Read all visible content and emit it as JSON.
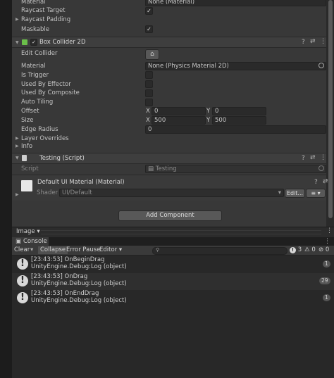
{
  "inspector": {
    "image_component": {
      "material_label": "Material",
      "material_value": "None (Material)",
      "raycast_target_label": "Raycast Target",
      "raycast_padding_label": "Raycast Padding",
      "maskable_label": "Maskable"
    },
    "box_collider": {
      "title": "Box Collider 2D",
      "edit_collider_label": "Edit Collider",
      "material_label": "Material",
      "material_value": "None (Physics Material 2D)",
      "is_trigger_label": "Is Trigger",
      "used_by_effector_label": "Used By Effector",
      "used_by_composite_label": "Used By Composite",
      "auto_tiling_label": "Auto Tiling",
      "offset_label": "Offset",
      "offset_x": "0",
      "offset_y": "0",
      "size_label": "Size",
      "size_x": "500",
      "size_y": "500",
      "edge_radius_label": "Edge Radius",
      "edge_radius_value": "0",
      "layer_overrides_label": "Layer Overrides",
      "info_label": "Info",
      "x_label": "X",
      "y_label": "Y"
    },
    "testing_script": {
      "title": "Testing (Script)",
      "script_label": "Script",
      "script_value": "Testing"
    },
    "material": {
      "title": "Default UI Material (Material)",
      "shader_label": "Shader",
      "shader_value": "UI/Default",
      "edit_label": "Edit..."
    },
    "add_component_label": "Add Component",
    "preview_label": "Image"
  },
  "console": {
    "tab_label": "Console",
    "toolbar": {
      "clear": "Clear",
      "collapse": "Collapse",
      "error_pause": "Error Pause",
      "editor": "Editor",
      "warn_count": "3",
      "info_count": "0",
      "error_count": "0"
    },
    "logs": [
      {
        "line1": "[23:43:53] OnBeginDrag",
        "line2": "UnityEngine.Debug:Log (object)",
        "count": "1"
      },
      {
        "line1": "[23:43:53] OnDrag",
        "line2": "UnityEngine.Debug:Log (object)",
        "count": "29"
      },
      {
        "line1": "[23:43:53] OnEndDrag",
        "line2": "UnityEngine.Debug:Log (object)",
        "count": "1"
      }
    ]
  },
  "colors": {
    "panel": "#383838",
    "header": "#3e3e3e",
    "field": "#2a2a2a",
    "console_bg": "#282828",
    "accent_green": "#6bbf4a"
  }
}
